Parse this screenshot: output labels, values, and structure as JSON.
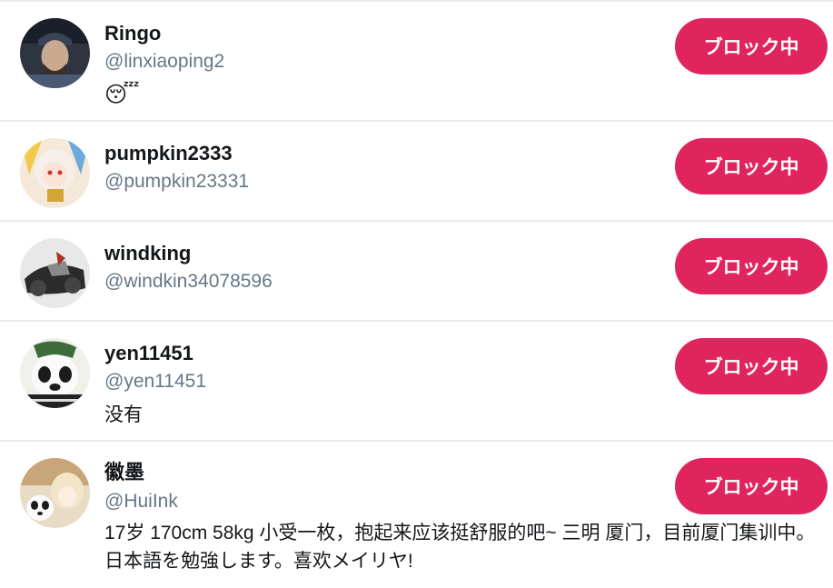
{
  "users": [
    {
      "name": "Ringo",
      "handle": "@linxiaoping2",
      "bio": "😴",
      "button": "ブロック中"
    },
    {
      "name": "pumpkin2333",
      "handle": "@pumpkin23331",
      "bio": "",
      "button": "ブロック中"
    },
    {
      "name": "windking",
      "handle": "@windkin34078596",
      "bio": "",
      "button": "ブロック中"
    },
    {
      "name": "yen11451",
      "handle": "@yen11451",
      "bio": "没有",
      "button": "ブロック中"
    },
    {
      "name": "徽墨",
      "handle": "@HuiInk",
      "bio": "17岁 170cm 58kg 小受一枚，抱起来应该挺舒服的吧~ 三明 厦门，目前厦门集训中。日本語を勉強します。喜欢メイリヤ!",
      "button": "ブロック中"
    }
  ],
  "colors": {
    "block_button": "#e0245e",
    "handle": "#657786",
    "divider": "#e6ecf0"
  }
}
